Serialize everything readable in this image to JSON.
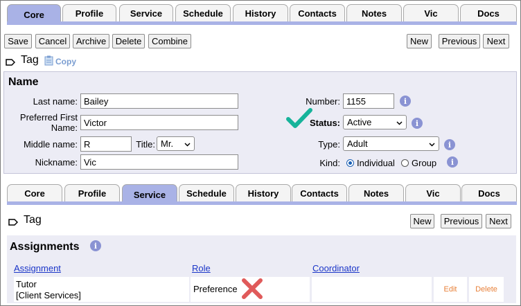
{
  "top_tabs": [
    {
      "label": "Core",
      "active": true
    },
    {
      "label": "Profile"
    },
    {
      "label": "Service"
    },
    {
      "label": "Schedule"
    },
    {
      "label": "History"
    },
    {
      "label": "Contacts"
    },
    {
      "label": "Notes"
    },
    {
      "label": "Vic"
    },
    {
      "label": "Docs"
    }
  ],
  "toolbar": {
    "save": "Save",
    "cancel": "Cancel",
    "archive": "Archive",
    "delete": "Delete",
    "combine": "Combine",
    "new": "New",
    "previous": "Previous",
    "next": "Next"
  },
  "tag": {
    "label": "Tag",
    "copy": "Copy"
  },
  "name_panel": {
    "title": "Name",
    "last_name_label": "Last name:",
    "last_name": "Bailey",
    "preferred_first_label_1": "Preferred First",
    "preferred_first_label_2": "Name:",
    "preferred_first": "Victor",
    "middle_name_label": "Middle name:",
    "middle_name": "R",
    "title_label": "Title:",
    "title_value": "Mr.",
    "nickname_label": "Nickname:",
    "nickname": "Vic",
    "number_label": "Number:",
    "number": "1155",
    "status_label": "Status:",
    "status": "Active",
    "type_label": "Type:",
    "type": "Adult",
    "kind_label": "Kind:",
    "kind_individual": "Individual",
    "kind_group": "Group",
    "kind_selected": "Individual"
  },
  "bottom_tabs": [
    {
      "label": "Core"
    },
    {
      "label": "Profile"
    },
    {
      "label": "Service",
      "active": true
    },
    {
      "label": "Schedule"
    },
    {
      "label": "History"
    },
    {
      "label": "Contacts"
    },
    {
      "label": "Notes"
    },
    {
      "label": "Vic"
    },
    {
      "label": "Docs"
    }
  ],
  "bottom_toolbar": {
    "new": "New",
    "previous": "Previous",
    "next": "Next"
  },
  "bottom_tag": {
    "label": "Tag"
  },
  "assignments": {
    "title": "Assignments",
    "columns": [
      "Assignment",
      "Role",
      "Coordinator"
    ],
    "rows": [
      {
        "assignment_1": "Tutor",
        "assignment_2": "[Client Services]",
        "role": "Preference",
        "coordinator": "",
        "edit": "Edit",
        "delete": "Delete"
      }
    ]
  },
  "colors": {
    "tab_active": "#a9b2e6",
    "panel_bg": "#ececf5",
    "link": "#1a35c8",
    "action": "#e8813a",
    "check": "#16b39a",
    "cross": "#e05a5a"
  }
}
